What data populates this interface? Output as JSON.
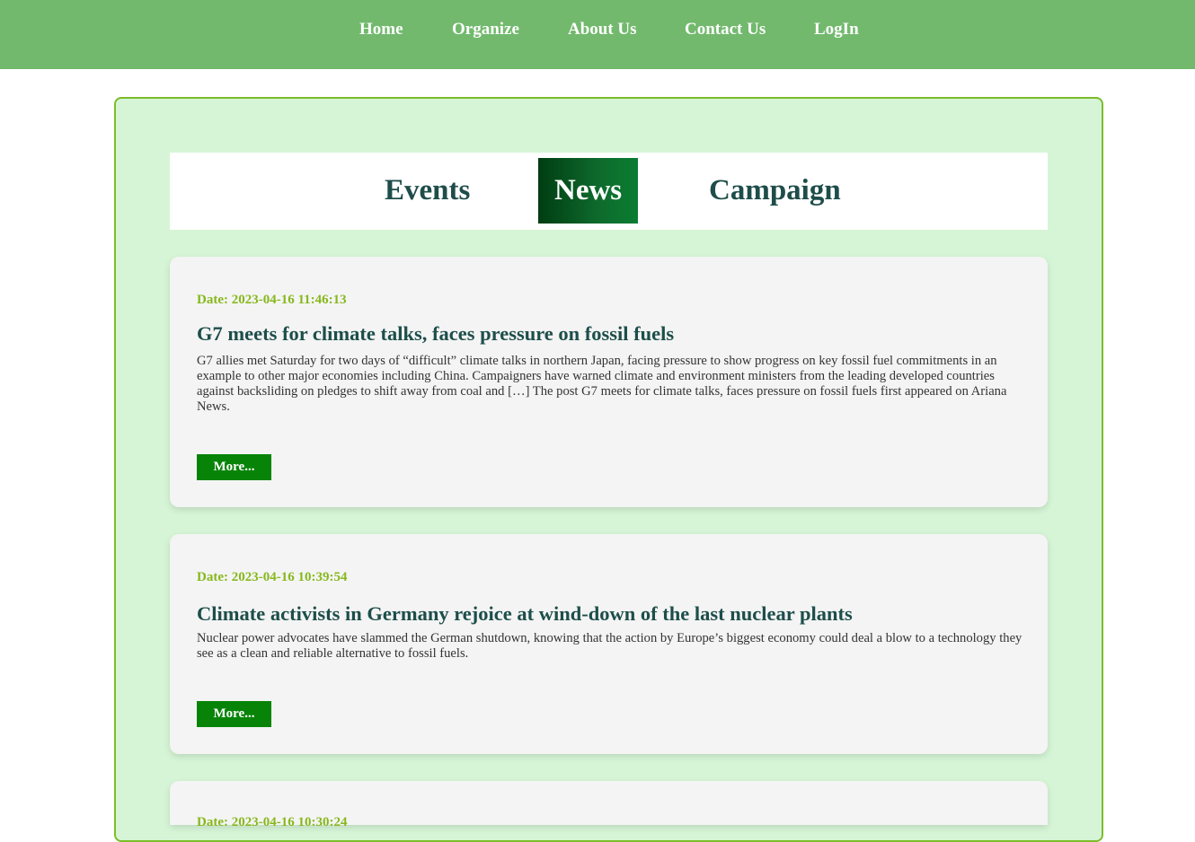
{
  "nav": {
    "items": [
      {
        "label": "Home"
      },
      {
        "label": "Organize"
      },
      {
        "label": "About Us"
      },
      {
        "label": "Contact Us"
      },
      {
        "label": "LogIn"
      }
    ]
  },
  "tabs": [
    {
      "label": "Events",
      "active": false
    },
    {
      "label": "News",
      "active": true
    },
    {
      "label": "Campaign",
      "active": false
    }
  ],
  "news": [
    {
      "date": "Date: 2023-04-16 11:46:13",
      "title": "G7 meets for climate talks, faces pressure on fossil fuels",
      "text": "G7 allies met Saturday for two days of “difficult” climate talks in northern Japan, facing pressure to show progress on key fossil fuel commitments in an example to other major economies including China. Campaigners have warned climate and environment ministers from the leading developed countries against backsliding on pledges to shift away from coal and […] The post G7 meets for climate talks, faces pressure on fossil fuels first appeared on Ariana News.",
      "button": "More..."
    },
    {
      "date": "Date: 2023-04-16 10:39:54",
      "title": "Climate activists in Germany rejoice at wind-down of the last nuclear plants",
      "text": "Nuclear power advocates have slammed the German shutdown, knowing that the action by Europe’s biggest economy could deal a blow to a technology they see as a clean and reliable alternative to fossil fuels.",
      "button": "More..."
    },
    {
      "date": "Date: 2023-04-16 10:30:24",
      "title": "",
      "text": "",
      "button": ""
    }
  ],
  "colors": {
    "topbar": "#72b96d",
    "panel_bg": "#d6f5d6",
    "panel_border": "#7cbc2a",
    "date": "#86b81c",
    "title": "#1d4e4a",
    "button": "#078408"
  }
}
